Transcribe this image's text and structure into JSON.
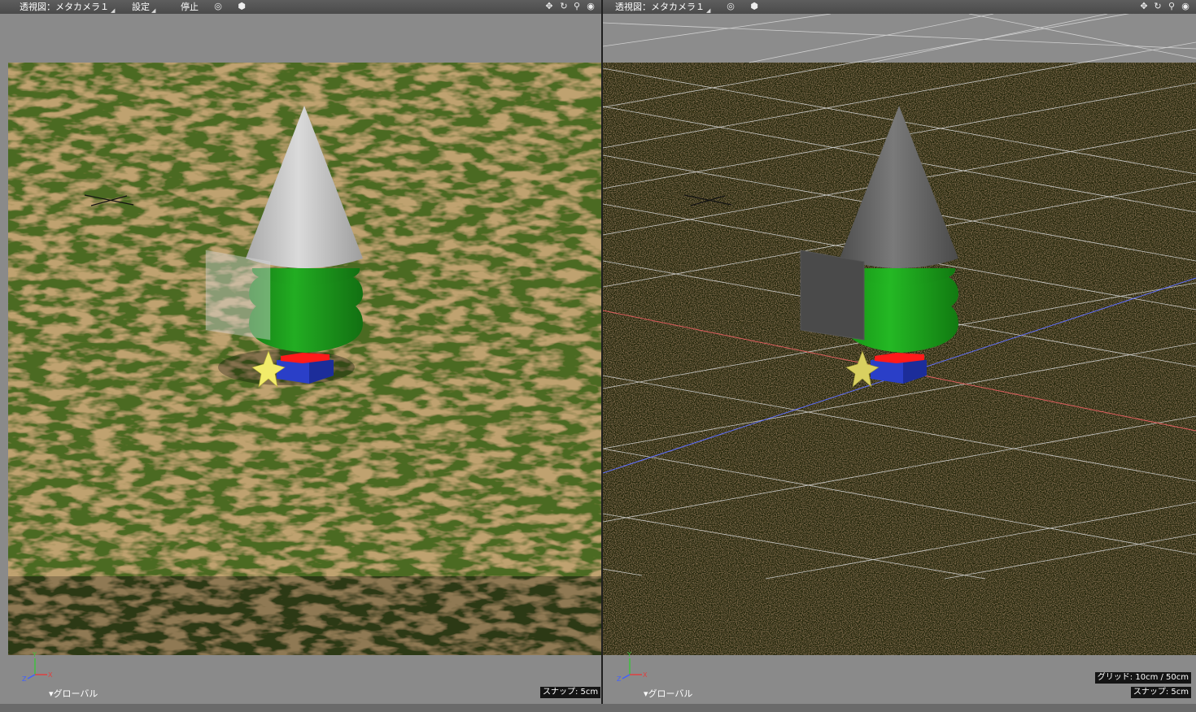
{
  "left_viewport": {
    "view_label": "透視図：メタカメラ１",
    "settings_label": "設定",
    "stop_label": "停止",
    "mode_label": "▾グローバル",
    "snap_label": "スナップ: 5cm",
    "axis_x": "X",
    "axis_y": "Y",
    "axis_z": "Z"
  },
  "right_viewport": {
    "view_label": "透視図：メタカメラ１",
    "mode_label": "▾グローバル",
    "grid_label": "グリッド: 10cm / 50cm",
    "snap_label": "スナップ: 5cm",
    "axis_x": "X",
    "axis_y": "Y",
    "axis_z": "Z"
  },
  "icons": {
    "view_mode": "target-icon",
    "shading": "cube-icon",
    "move": "move-icon",
    "rotate": "rotate-icon",
    "zoom": "zoom-icon",
    "fit": "fit-icon"
  },
  "colors": {
    "grass": "#4a6a24",
    "dark_floor": "#23260f",
    "cone_light": "#c7c7c7",
    "cone_dark": "#6a6a6a",
    "tree_green": "#1f9a1f",
    "base_red": "#ff1a1a",
    "base_blue": "#2a3fc8",
    "star": "#f2ec6a",
    "axis_x": "#e04040",
    "axis_y": "#40c040",
    "axis_z": "#4060ff"
  }
}
